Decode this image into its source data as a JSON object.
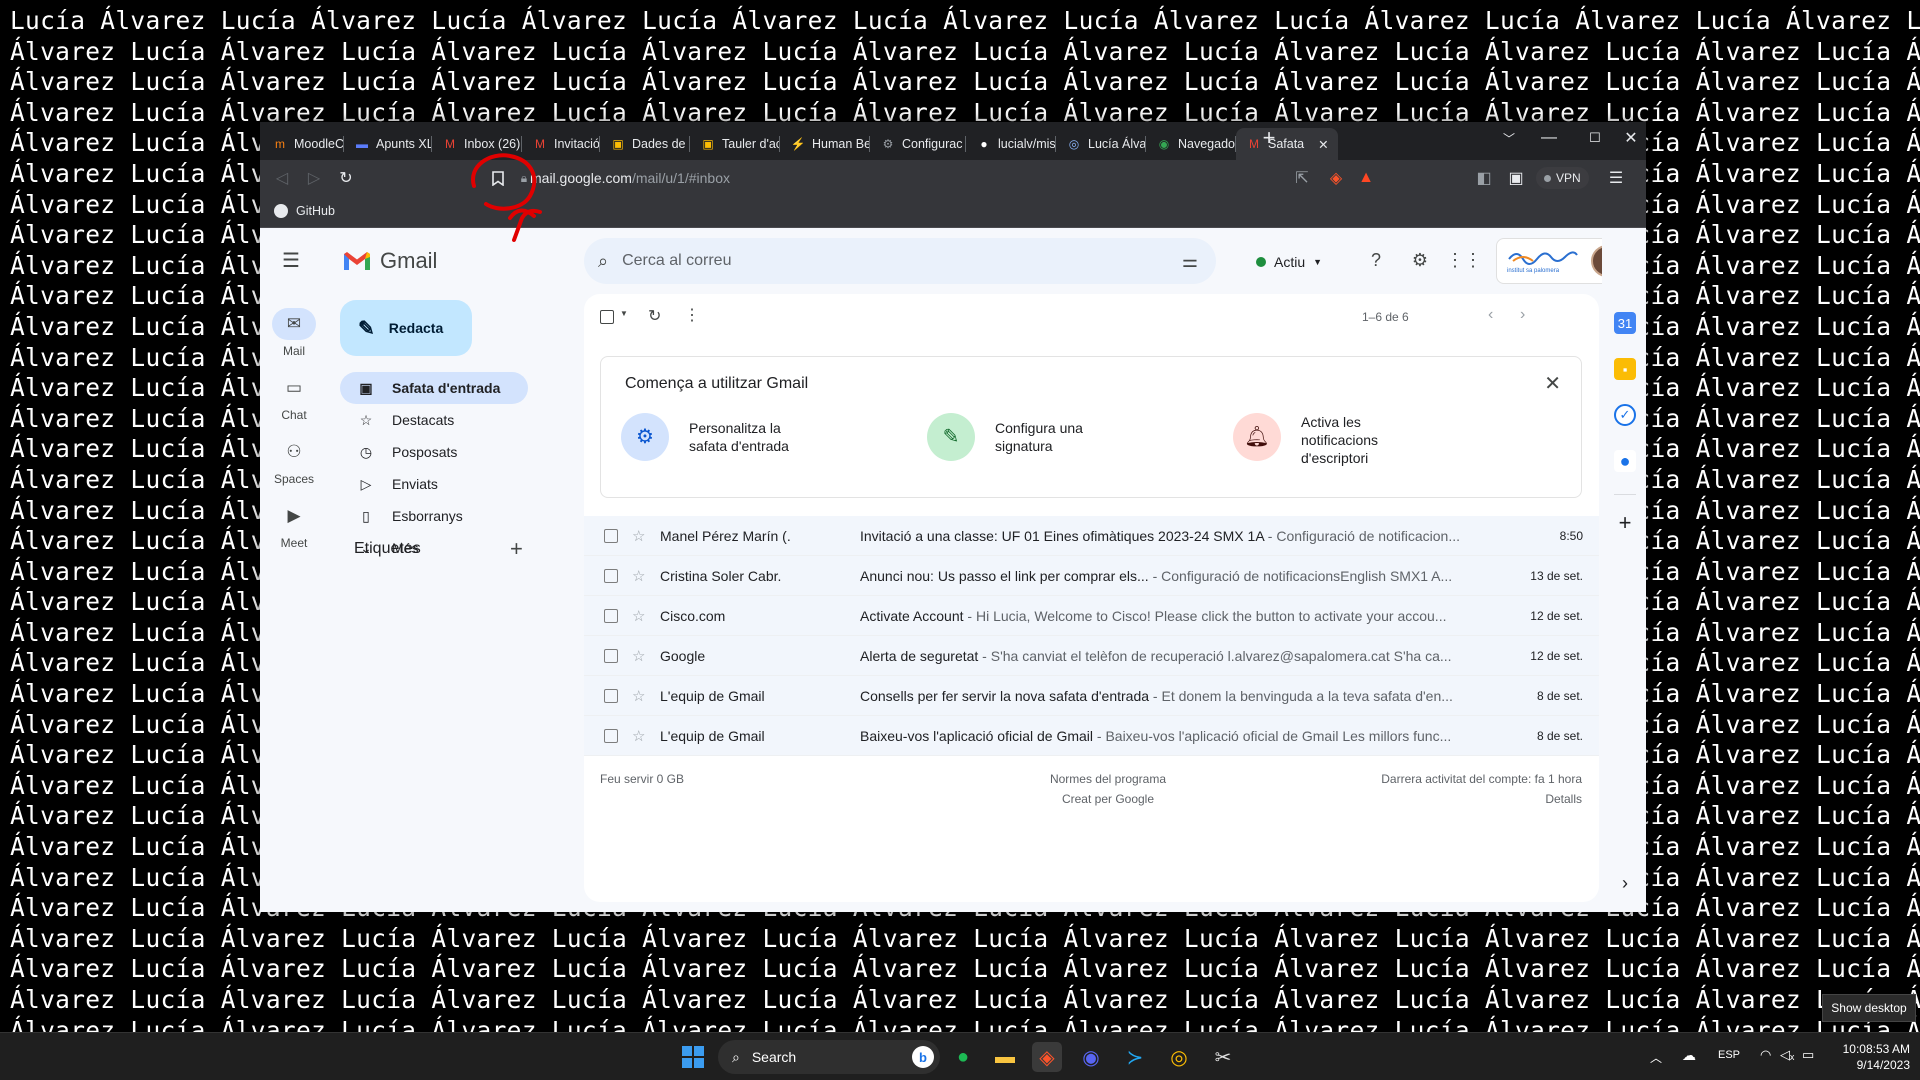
{
  "wallpaper": {
    "text": "Lucía Álvarez",
    "color": "#ffffff"
  },
  "browser": {
    "tabs": [
      {
        "label": "MoodleCF",
        "favicon_color": "#f98012",
        "glyph": "m"
      },
      {
        "label": "Apunts XL",
        "favicon_color": "#5b7cfa",
        "glyph": "▬"
      },
      {
        "label": "Inbox (26)",
        "favicon_color": "#ea4335",
        "glyph": "M"
      },
      {
        "label": "Invitació a",
        "favicon_color": "#ea4335",
        "glyph": "M"
      },
      {
        "label": "Dades de",
        "favicon_color": "#fbbc04",
        "glyph": "▣"
      },
      {
        "label": "Tauler d'ac",
        "favicon_color": "#fbbc04",
        "glyph": "▣"
      },
      {
        "label": "Human Be",
        "favicon_color": "#f7b500",
        "glyph": "⚡"
      },
      {
        "label": "Configurac",
        "favicon_color": "#9aa0a6",
        "glyph": "⚙"
      },
      {
        "label": "lucialv/mis",
        "favicon_color": "#ffffff",
        "glyph": "●"
      },
      {
        "label": "Lucía Álvar",
        "favicon_color": "#8ab4f8",
        "glyph": "◎"
      },
      {
        "label": "Navegado",
        "favicon_color": "#34a853",
        "glyph": "◉"
      },
      {
        "label": "Safata",
        "favicon_color": "#ea4335",
        "glyph": "M"
      }
    ],
    "new_tab": "+",
    "url_host": "mail.google.com",
    "url_path": "/mail/u/1/#inbox",
    "vpn_label": "VPN",
    "bookmark_github": "GitHub"
  },
  "gmail": {
    "product_name": "Gmail",
    "rail": [
      {
        "label": "Mail",
        "icon": "mail-icon"
      },
      {
        "label": "Chat",
        "icon": "chat-icon"
      },
      {
        "label": "Spaces",
        "icon": "spaces-icon"
      },
      {
        "label": "Meet",
        "icon": "meet-icon"
      }
    ],
    "compose_label": "Redacta",
    "nav": [
      {
        "label": "Safata d'entrada",
        "icon": "inbox-icon",
        "active": true
      },
      {
        "label": "Destacats",
        "icon": "star-icon"
      },
      {
        "label": "Posposats",
        "icon": "clock-icon"
      },
      {
        "label": "Enviats",
        "icon": "send-icon"
      },
      {
        "label": "Esborranys",
        "icon": "draft-icon"
      },
      {
        "label": "Més",
        "icon": "chevron-down-icon"
      }
    ],
    "labels_heading": "Etiquetes",
    "search_placeholder": "Cerca al correu",
    "status_label": "Actiu",
    "pagination": "1–6 de 6",
    "setup_card": {
      "title": "Comença a utilitzar Gmail",
      "steps": [
        {
          "line1": "Personalitza la",
          "line2": "safata d'entrada",
          "line3": ""
        },
        {
          "line1": "Configura una",
          "line2": "signatura",
          "line3": ""
        },
        {
          "line1": "Activa les",
          "line2": "notificacions",
          "line3": "d'escriptori"
        }
      ]
    },
    "emails": [
      {
        "from": "Manel Pérez Marín (.",
        "subject": "Invitació a una classe: UF 01 Eines ofimàtiques 2023-24 SMX 1A",
        "snippet": " - Configuració de notificacion...",
        "date": "8:50"
      },
      {
        "from": "Cristina Soler Cabr.",
        "subject": "Anunci nou: Us passo el link per comprar els...",
        "snippet": " - Configuració de notificacionsEnglish SMX1 A...",
        "date": "13 de set."
      },
      {
        "from": "Cisco.com",
        "subject": "Activate Account",
        "snippet": " - Hi Lucia, Welcome to Cisco! Please click the button to activate your accou...",
        "date": "12 de set."
      },
      {
        "from": "Google",
        "subject": "Alerta de seguretat",
        "snippet": " - S'ha canviat el telèfon de recuperació l.alvarez@sapalomera.cat S'ha ca...",
        "date": "12 de set."
      },
      {
        "from": "L'equip de Gmail",
        "subject": "Consells per fer servir la nova safata d'entrada",
        "snippet": " - Et donem la benvinguda a la teva safata d'en...",
        "date": "8 de set."
      },
      {
        "from": "L'equip de Gmail",
        "subject": "Baixeu-vos l'aplicació oficial de Gmail",
        "snippet": " - Baixeu-vos l'aplicació oficial de Gmail Les millors func...",
        "date": "8 de set."
      }
    ],
    "footer": {
      "storage": "Feu servir 0 GB",
      "policies": "Normes del programa",
      "powered": "Creat per Google",
      "activity": "Darrera activitat del compte: fa 1 hora",
      "details": "Detalls"
    },
    "account_logo_text": "institut sa palomera"
  },
  "taskbar": {
    "search_label": "Search",
    "lang": "ESP",
    "time": "10:08:53 AM",
    "date": "9/14/2023",
    "show_desktop": "Show desktop"
  },
  "colors": {
    "gmail_accent": "#0b57d0",
    "compose_bg": "#c2e7ff",
    "active_nav": "#d3e3fd",
    "annotation": "#e00000"
  }
}
